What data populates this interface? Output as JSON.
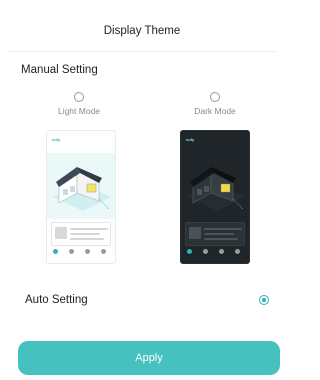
{
  "header": {
    "title": "Display Theme"
  },
  "manual": {
    "section_title": "Manual Setting",
    "light_label": "Light Mode",
    "dark_label": "Dark Mode",
    "logo_text": "eufy",
    "light_selected": false,
    "dark_selected": false,
    "preview_pages": 4,
    "active_page": 1
  },
  "auto": {
    "label": "Auto Setting",
    "selected": true
  },
  "actions": {
    "apply_label": "Apply"
  },
  "colors": {
    "accent": "#45c1bf",
    "accent_dark": "#2fb3b3",
    "dark_bg": "#1f2528"
  }
}
